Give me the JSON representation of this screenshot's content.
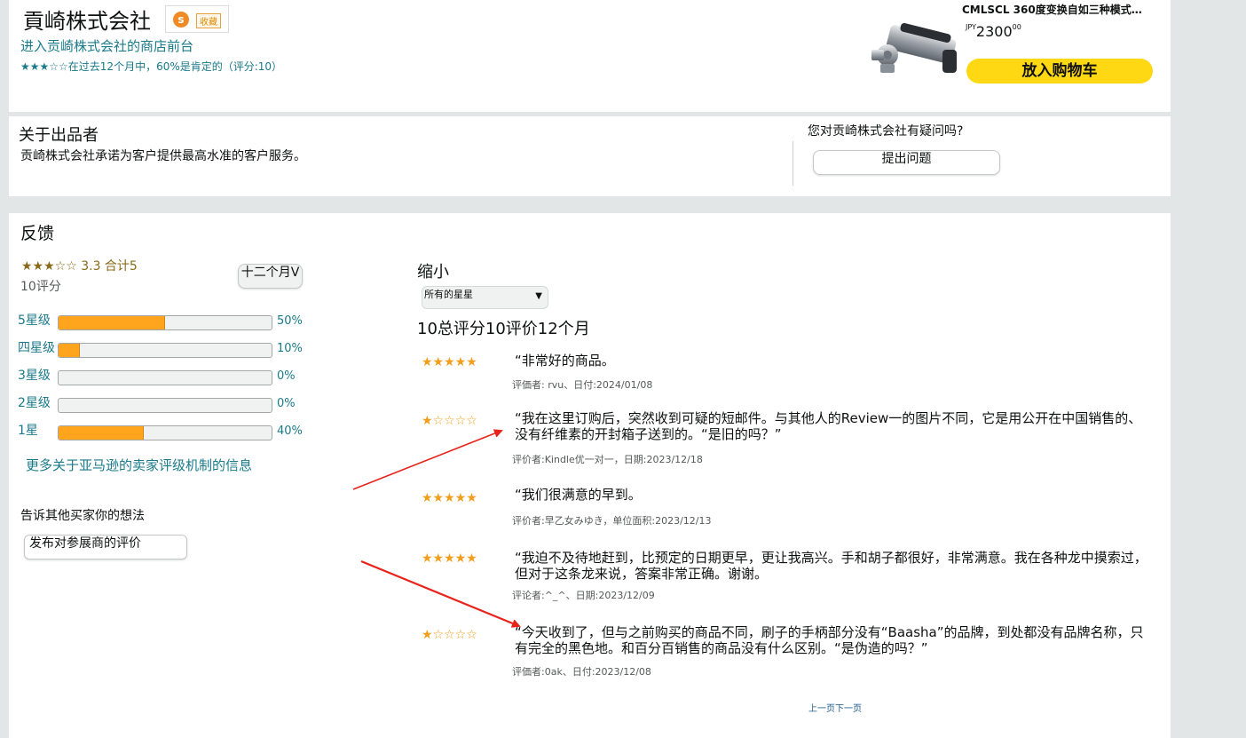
{
  "seller": {
    "name": "貢崎株式会社",
    "badge_icon": "s",
    "fav_label": "收藏",
    "storefront_link": "进入贡崎株式会社的商店前台",
    "rating_stars": "★★★☆☆",
    "rating_summary": "在过去12个月中，60%是肯定的（评分:10）"
  },
  "product": {
    "title": "CMLSCL 360度变换自如三种模式…",
    "currency": "JPY",
    "price_whole": "2300",
    "price_fraction": "00",
    "add_to_cart": "放入购物车"
  },
  "about": {
    "heading": "关于出品者",
    "text": "贡崎株式会社承诺为客户提供最高水准的客户服务。",
    "question": "您对贡崎株式会社有疑问吗?",
    "ask_button": "提出问题"
  },
  "feedback": {
    "heading": "反馈",
    "stars": "★★★☆☆",
    "score_text": "3.3 合计5",
    "count_text": "10评分",
    "period_button": "十二个月V",
    "histogram": [
      {
        "label": "5星级",
        "percent_text": "50%",
        "value": 50
      },
      {
        "label": "四星级",
        "percent_text": "10%",
        "value": 10
      },
      {
        "label": "3星级",
        "percent_text": "0%",
        "value": 0
      },
      {
        "label": "2星级",
        "percent_text": "0%",
        "value": 0
      },
      {
        "label": "1星",
        "percent_text": "40%",
        "value": 40
      }
    ],
    "more_info_link": "更多关于亚马逊的卖家评级机制的信息",
    "tell_others": "告诉其他买家你的想法",
    "post_review_button": "发布对参展商的评价",
    "filter_heading": "缩小",
    "filter_select": "所有的星星",
    "summary_line": "10总评分10评价12个月",
    "pagination": "上一页下一页",
    "colors": {
      "bar": "#ffa41c",
      "star": "#f29d1b",
      "link": "#1a7a8a",
      "arrow": "#e8231b",
      "cart": "#ffd814"
    }
  },
  "reviews": [
    {
      "stars": "★★★★★",
      "text": "“非常好的商品。",
      "meta": "评価者: rvu、日付:2024/01/08"
    },
    {
      "stars": "★☆☆☆☆",
      "text": "“我在这里订购后，突然收到可疑的短邮件。与其他人的Review一的图片不同，它是用公开在中国销售的、没有纤维素的开封箱子送到的。“是旧的吗？”",
      "meta": "评价者:Kindle优一对一，日期:2023/12/18"
    },
    {
      "stars": "★★★★★",
      "text": "“我们很满意的早到。",
      "meta": "评价者:早乙女みゆき，单位面积:2023/12/13"
    },
    {
      "stars": "★★★★★",
      "text": "“我迫不及待地赶到，比预定的日期更早，更让我高兴。手和胡子都很好，非常满意。我在各种龙中摸索过，但对于这条龙来说，答案非常正确。谢谢。",
      "meta": "评论者:^_^、日期:2023/12/09"
    },
    {
      "stars": "★☆☆☆☆",
      "text": "“今天收到了，但与之前购买的商品不同，刷子的手柄部分没有“Baasha”的品牌，到处都没有品牌名称，只有完全的黑色地。和百分百销售的商品没有什么区别。“是伪造的吗？”",
      "meta": "评価者:0ak、日付:2023/12/08"
    }
  ]
}
